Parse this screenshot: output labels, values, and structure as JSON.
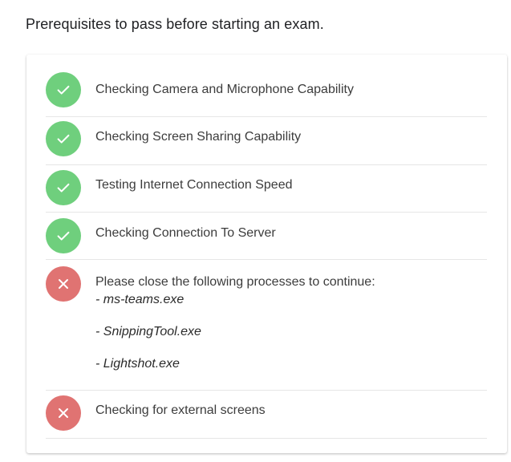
{
  "page": {
    "title": "Prerequisites to pass before starting an exam."
  },
  "checks": [
    {
      "label": "Checking Camera and Microphone Capability",
      "status": "passed",
      "icon": "check-icon"
    },
    {
      "label": "Checking Screen Sharing Capability",
      "status": "passed",
      "icon": "check-icon"
    },
    {
      "label": "Testing Internet Connection Speed",
      "status": "passed",
      "icon": "check-icon"
    },
    {
      "label": "Checking Connection To Server",
      "status": "passed",
      "icon": "check-icon"
    },
    {
      "label": "Please close the following processes to continue:",
      "status": "failed",
      "icon": "x-icon",
      "processes": [
        "- ms-teams.exe",
        "- SnippingTool.exe",
        "- Lightshot.exe"
      ]
    },
    {
      "label": "Checking for external screens",
      "status": "failed",
      "icon": "x-icon"
    }
  ],
  "colors": {
    "passed": "#6fcf7d",
    "failed": "#e07372",
    "divider": "#e6e6e6"
  }
}
